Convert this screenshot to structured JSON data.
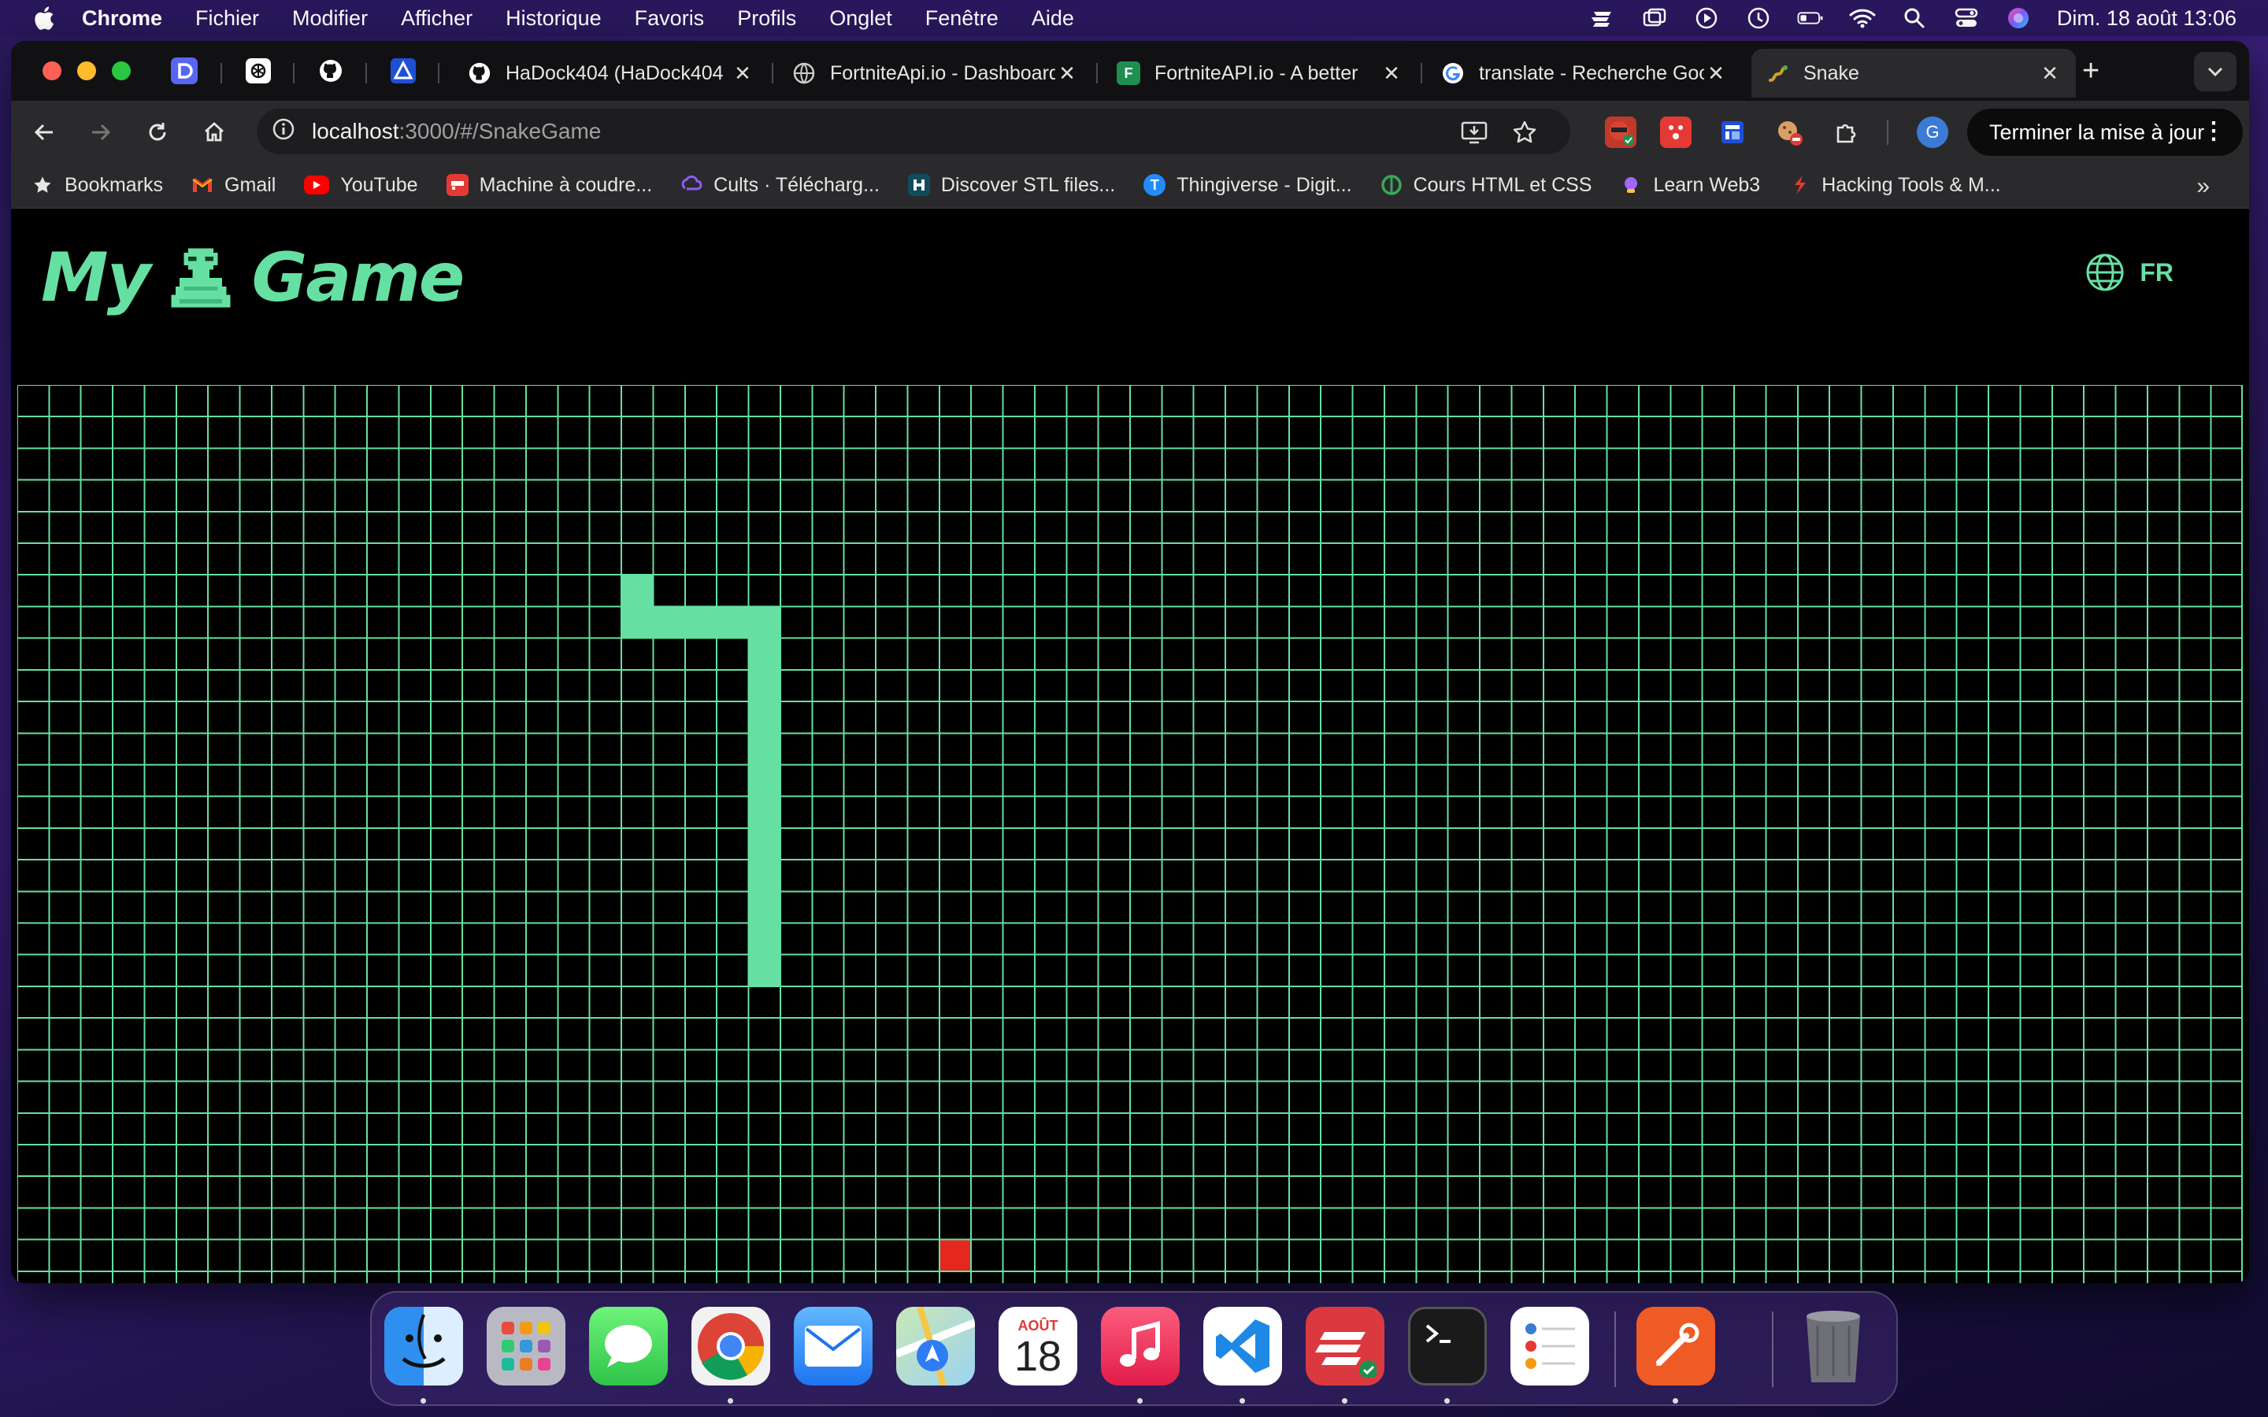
{
  "menubar": {
    "items": [
      "Chrome",
      "Fichier",
      "Modifier",
      "Afficher",
      "Historique",
      "Favoris",
      "Profils",
      "Onglet",
      "Fenêtre",
      "Aide"
    ],
    "datetime": "Dim. 18 août 13:06"
  },
  "tabs": [
    {
      "title": "HaDock404 (HaDock404",
      "icon": "github-icon"
    },
    {
      "title": "FortniteApi.io - Dashboard",
      "icon": "globe-icon"
    },
    {
      "title": "FortniteAPI.io - A better",
      "icon": "fortnite-icon"
    },
    {
      "title": "translate - Recherche Google",
      "icon": "google-icon"
    },
    {
      "title": "Snake",
      "icon": "snake-icon",
      "active": true
    }
  ],
  "address": {
    "host": "localhost",
    "path": ":3000/#/SnakeGame"
  },
  "profile_initial": "G",
  "update_button": "Terminer la mise à jour",
  "bookmarks": [
    {
      "label": "Bookmarks",
      "icon": "star-icon"
    },
    {
      "label": "Gmail",
      "icon": "gmail-icon"
    },
    {
      "label": "YouTube",
      "icon": "youtube-icon"
    },
    {
      "label": "Machine à coudre...",
      "icon": "sewing-icon"
    },
    {
      "label": "Cults · Télécharg...",
      "icon": "cults-icon"
    },
    {
      "label": "Discover STL files...",
      "icon": "stl-icon"
    },
    {
      "label": "Thingiverse - Digit...",
      "icon": "thingiverse-icon"
    },
    {
      "label": "Cours HTML et CSS",
      "icon": "openclassrooms-icon"
    },
    {
      "label": "Learn Web3",
      "icon": "web3-icon"
    },
    {
      "label": "Hacking Tools & M...",
      "icon": "hacking-icon"
    }
  ],
  "app": {
    "logo_left": "My",
    "logo_right": "Game",
    "language": "FR",
    "colors": {
      "accent": "#66e0a2",
      "food": "#e5271f",
      "background": "#000000"
    }
  },
  "game": {
    "cols": 70,
    "rows": 29,
    "snake": [
      [
        19,
        7
      ],
      [
        20,
        7
      ],
      [
        21,
        7
      ],
      [
        22,
        7
      ],
      [
        23,
        7
      ],
      [
        23,
        8
      ],
      [
        23,
        9
      ],
      [
        23,
        10
      ],
      [
        23,
        11
      ],
      [
        23,
        12
      ],
      [
        23,
        13
      ],
      [
        23,
        14
      ],
      [
        23,
        15
      ],
      [
        23,
        16
      ],
      [
        23,
        17
      ],
      [
        23,
        18
      ],
      [
        19,
        6
      ]
    ],
    "food": [
      29,
      27
    ]
  },
  "dock": {
    "calendar_month": "AOÛT",
    "calendar_day": "18",
    "apps": [
      "finder-icon",
      "launchpad-icon",
      "messages-icon",
      "chrome-icon",
      "mail-icon",
      "maps-icon",
      "calendar-icon",
      "music-icon",
      "vscode-icon",
      "expressvpn-icon",
      "terminal-icon",
      "reminders-icon",
      "postman-icon",
      "trash-icon"
    ]
  }
}
